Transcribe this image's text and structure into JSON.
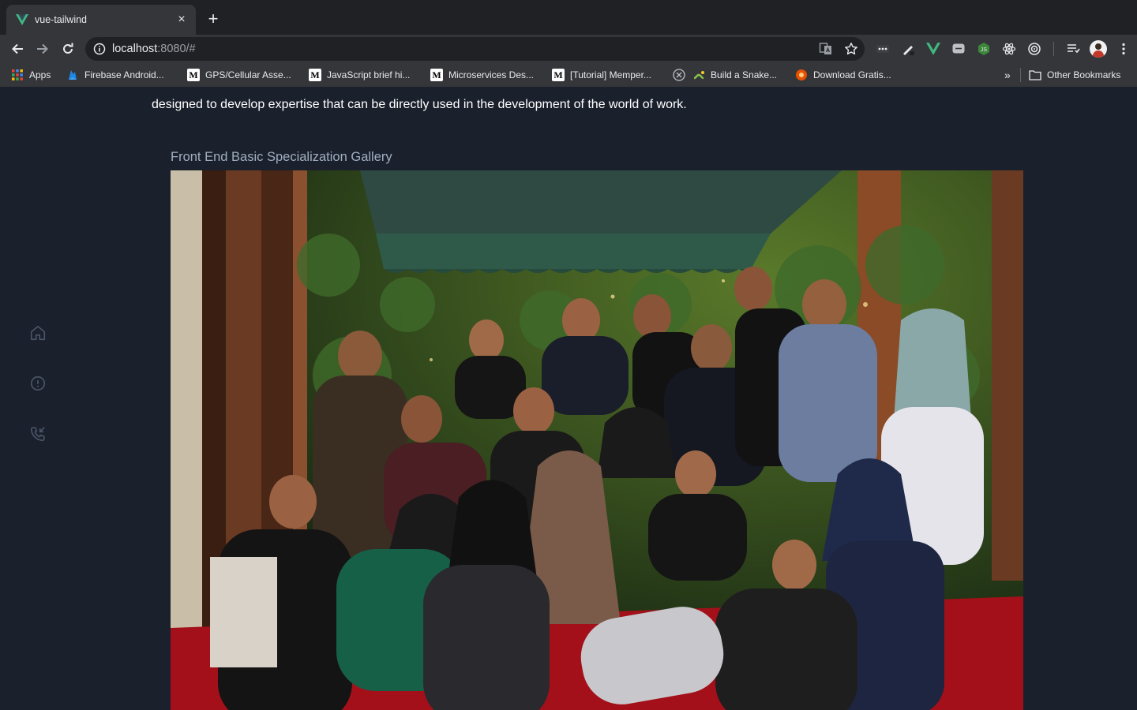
{
  "browser": {
    "tab": {
      "title": "vue-tailwind",
      "close_glyph": "×"
    },
    "new_tab_glyph": "+",
    "url": {
      "host": "localhost",
      "path": ":8080/#"
    },
    "bookmarks": [
      {
        "label": "Apps",
        "icon": "apps-grid-icon"
      },
      {
        "label": "Firebase Android...",
        "icon": "firebase-icon"
      },
      {
        "label": "GPS/Cellular Asse...",
        "icon": "medium-icon"
      },
      {
        "label": "JavaScript brief hi...",
        "icon": "medium-icon"
      },
      {
        "label": "Microservices Des...",
        "icon": "medium-icon"
      },
      {
        "label": "[Tutorial] Memper...",
        "icon": "medium-icon"
      },
      {
        "label": "Build a Snake...",
        "icon": "snake-icon"
      },
      {
        "label": "Download Gratis...",
        "icon": "download-icon"
      }
    ],
    "bookmarks_overflow": "»",
    "other_bookmarks": "Other Bookmarks",
    "medium_letter": "M"
  },
  "page": {
    "intro_text": "designed to develop expertise that can be directly used in the development of the world of work.",
    "gallery_title": "Front End Basic Specialization Gallery",
    "sidebar": [
      {
        "icon": "home-icon"
      },
      {
        "icon": "alert-circle-icon"
      },
      {
        "icon": "phone-incoming-icon"
      }
    ]
  },
  "colors": {
    "page_bg": "#1a202c",
    "sidebar_icon": "#4a5568",
    "gallery_title": "#a0aec0",
    "vue_green": "#41b883"
  }
}
